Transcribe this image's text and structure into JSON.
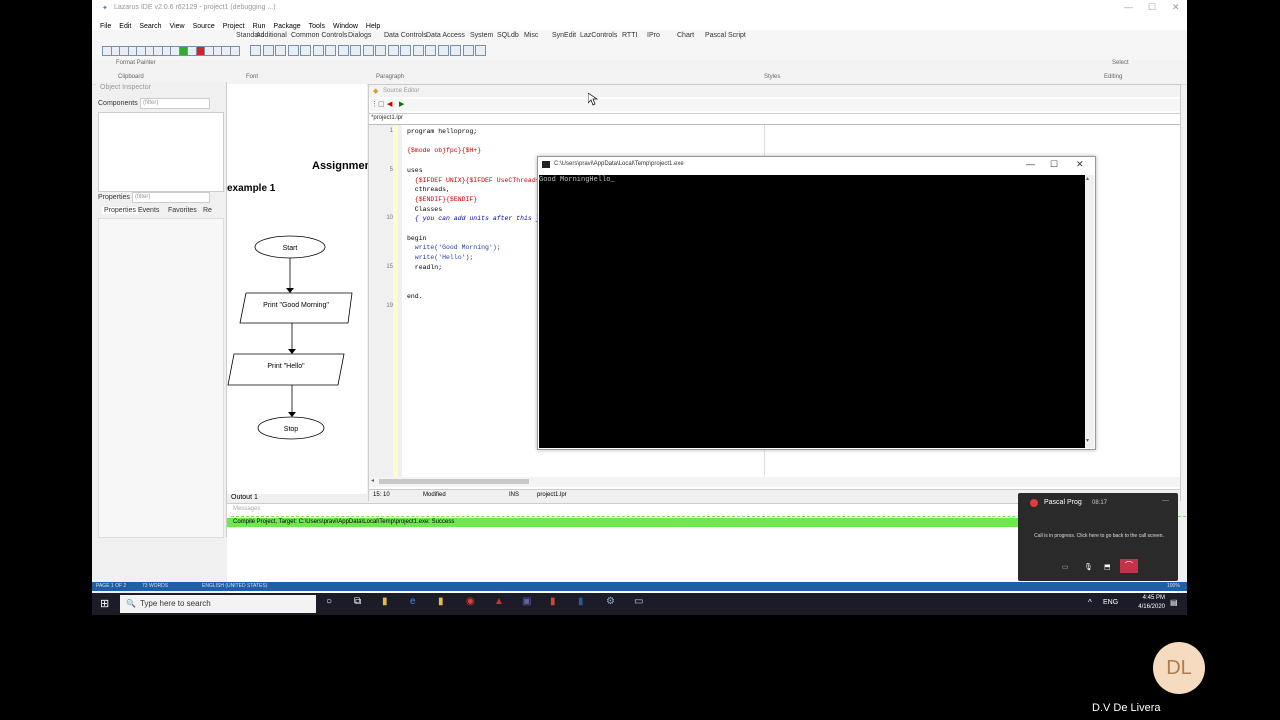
{
  "ide_title": "Lazarus IDE v2.0.6 r62129 - project1 (debugging ...)",
  "menu": [
    "File",
    "Edit",
    "Search",
    "View",
    "Source",
    "Project",
    "Run",
    "Package",
    "Tools",
    "Window",
    "Help"
  ],
  "component_tabs": [
    "Standard",
    "Additional",
    "Common Controls",
    "Dialogs",
    "Data Controls",
    "Data Access",
    "System",
    "SQLdb",
    "Misc",
    "SynEdit",
    "LazControls",
    "RTTI",
    "IPro",
    "Chart",
    "Pascal Script"
  ],
  "ribbon": {
    "clipboard": "Clipboard",
    "font": "Font",
    "paragraph": "Paragraph",
    "styles": "Styles",
    "editing": "Editing",
    "format_painter": "Format Painter",
    "select": "Select"
  },
  "object_inspector": {
    "title": "Object Inspector",
    "components_label": "Components",
    "filter_placeholder": "(filter)",
    "properties_label": "Properties",
    "tabs": [
      "Properties",
      "Events",
      "Favorites",
      "Re"
    ]
  },
  "document": {
    "heading": "Assignment",
    "subheading": "example 1"
  },
  "flowchart": {
    "start": "Start",
    "step1": "Print \"Good Morning\"",
    "step2": "Print \"Hello\"",
    "stop": "Stop"
  },
  "source_editor": {
    "title": "Source Editor",
    "tab": "*project1.lpr",
    "line_numbers": [
      "1",
      "",
      "",
      "",
      "5",
      "",
      "",
      "",
      "",
      "10",
      "",
      "",
      "",
      "",
      "15",
      "",
      "",
      "",
      "19"
    ],
    "lines": [
      "program helloprog;",
      "",
      "{$mode objfpc}{$H+}",
      "",
      "uses",
      "  {$IFDEF UNIX}{$IFDEF UseCThreads}",
      "  cthreads,",
      "  {$ENDIF}{$ENDIF}",
      "  Classes",
      "  { you can add units after this }",
      "",
      "begin",
      "  write('Good Morning');",
      "  write('Hello');",
      "  readln;",
      "",
      "",
      "end.",
      ""
    ],
    "status_pos": "15: 10",
    "status_modified": "Modified",
    "status_mode": "INS",
    "status_file": "project1.lpr"
  },
  "console": {
    "title": "C:\\Users\\pravi\\AppData\\Local\\Temp\\project1.exe",
    "output": "Good MorningHello_"
  },
  "messages": {
    "output_tab": "Outout 1",
    "header": "Messages",
    "success": "Compile Project, Target: C:\\Users\\pravi\\AppData\\Local\\Temp\\project1.exe: Success"
  },
  "call": {
    "name": "Pascal Prog",
    "time": "08:17",
    "text": "Call is in progress. Click here to go back to the call screen."
  },
  "word_status": {
    "page": "PAGE 1 OF 2",
    "words": "73 WORDS",
    "language": "ENGLISH (UNITED STATES)",
    "zoom": "100%"
  },
  "taskbar": {
    "search_placeholder": "Type here to search",
    "lang": "ENG",
    "time": "4:45 PM",
    "date": "4/16/2020"
  },
  "presenter": {
    "initials": "DL",
    "name": "D.V De  Livera"
  },
  "colors": {
    "success": "#6ee84e",
    "taskbar": "#1c1c28",
    "word_blue": "#1f5fa8",
    "avatar": "#f5dcc0"
  }
}
